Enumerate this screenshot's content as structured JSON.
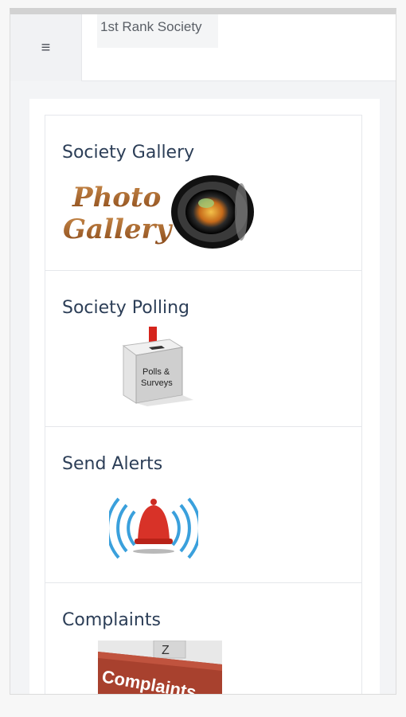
{
  "app": {
    "title": "1st Rank Society",
    "menu_icon": "≡"
  },
  "cards": [
    {
      "title": "Society Gallery",
      "image_text_1": "Photo",
      "image_text_2": "Gallery"
    },
    {
      "title": "Society Polling",
      "image_text_1": "Polls &",
      "image_text_2": "Surveys"
    },
    {
      "title": "Send Alerts"
    },
    {
      "title": "Complaints",
      "image_text": "Complaints"
    }
  ]
}
